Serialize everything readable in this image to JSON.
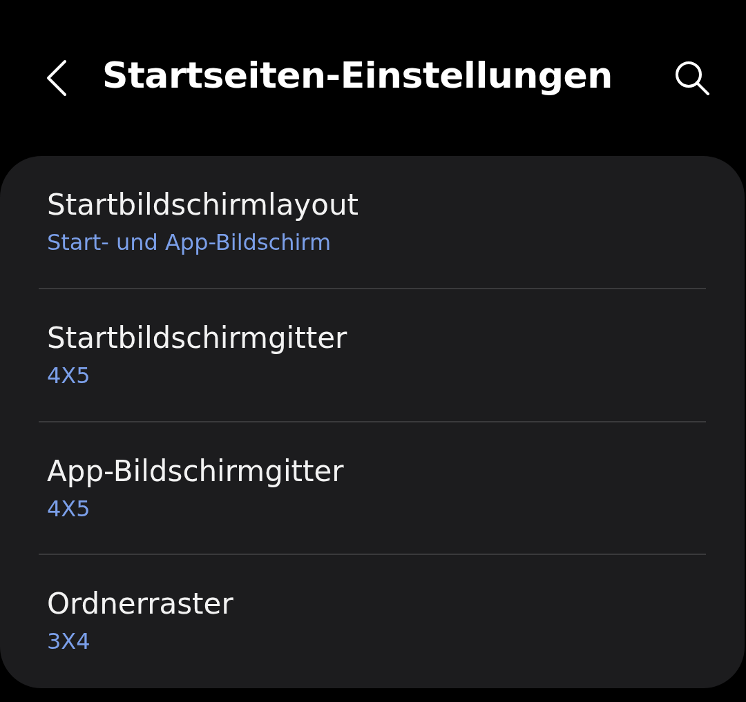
{
  "header": {
    "title": "Startseiten-Einstellungen"
  },
  "settings": [
    {
      "title": "Startbildschirmlayout",
      "value": "Start- und App-Bildschirm"
    },
    {
      "title": "Startbildschirmgitter",
      "value": "4X5"
    },
    {
      "title": "App-Bildschirmgitter",
      "value": "4X5"
    },
    {
      "title": "Ordnerraster",
      "value": "3X4"
    }
  ]
}
